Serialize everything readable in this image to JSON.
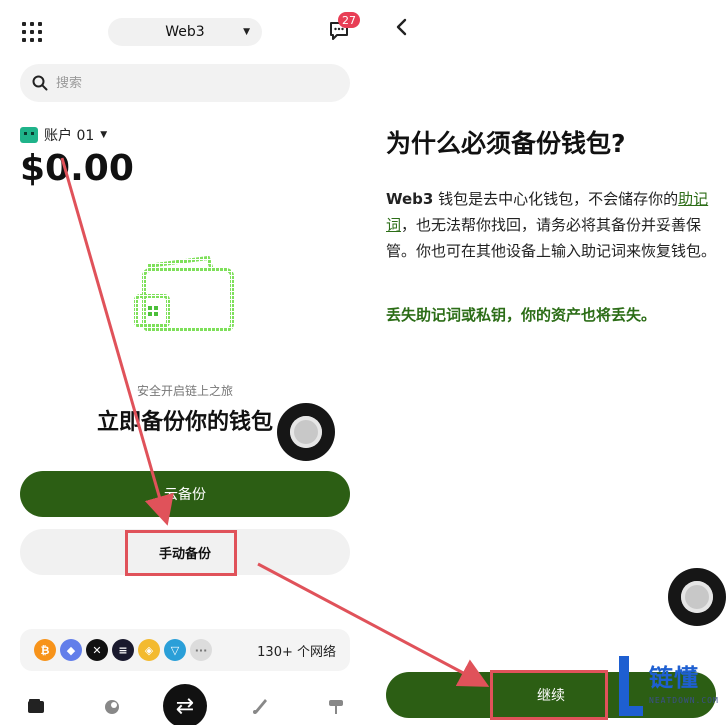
{
  "left": {
    "network_selector": "Web3",
    "message_badge": "27",
    "search_placeholder": "搜索",
    "account_name": "账户 01",
    "balance": "$0.00",
    "safety_text": "安全开启链上之旅",
    "backup_title": "立即备份你的钱包",
    "cloud_backup_label": "云备份",
    "manual_backup_label": "手动备份",
    "networks_count": "130+ 个网络",
    "coins": [
      {
        "name": "bitcoin-icon",
        "color": "#f7931a",
        "glyph": "₿"
      },
      {
        "name": "ethereum-icon",
        "color": "#627eea",
        "glyph": "◆"
      },
      {
        "name": "okx-icon",
        "color": "#111111",
        "glyph": "✕"
      },
      {
        "name": "solana-icon",
        "color": "#1a1a2e",
        "glyph": "≡"
      },
      {
        "name": "bnb-icon",
        "color": "#f3ba2f",
        "glyph": "◈"
      },
      {
        "name": "tron-icon",
        "color": "#2a9fd8",
        "glyph": "▽"
      }
    ]
  },
  "right": {
    "title": "为什么必须备份钱包?",
    "para_bold": "Web3",
    "para_1": " 钱包是去中心化钱包，不会储存你的",
    "para_link": "助记词",
    "para_2": "，也无法帮你找回，请务必将其备份并妥善保管。你也可在其他设备上输入助记词来恢复钱包。",
    "warning": "丢失助记词或私钥，你的资产也将丢失。",
    "continue_label": "继续"
  },
  "watermark": {
    "text": "链懂",
    "sub": "NEATDOWN.COM"
  },
  "colors": {
    "brand_green": "#2c5e14",
    "link_green": "#2c6d17",
    "highlight_red": "#e0525a",
    "badge_red": "#e83e55"
  }
}
